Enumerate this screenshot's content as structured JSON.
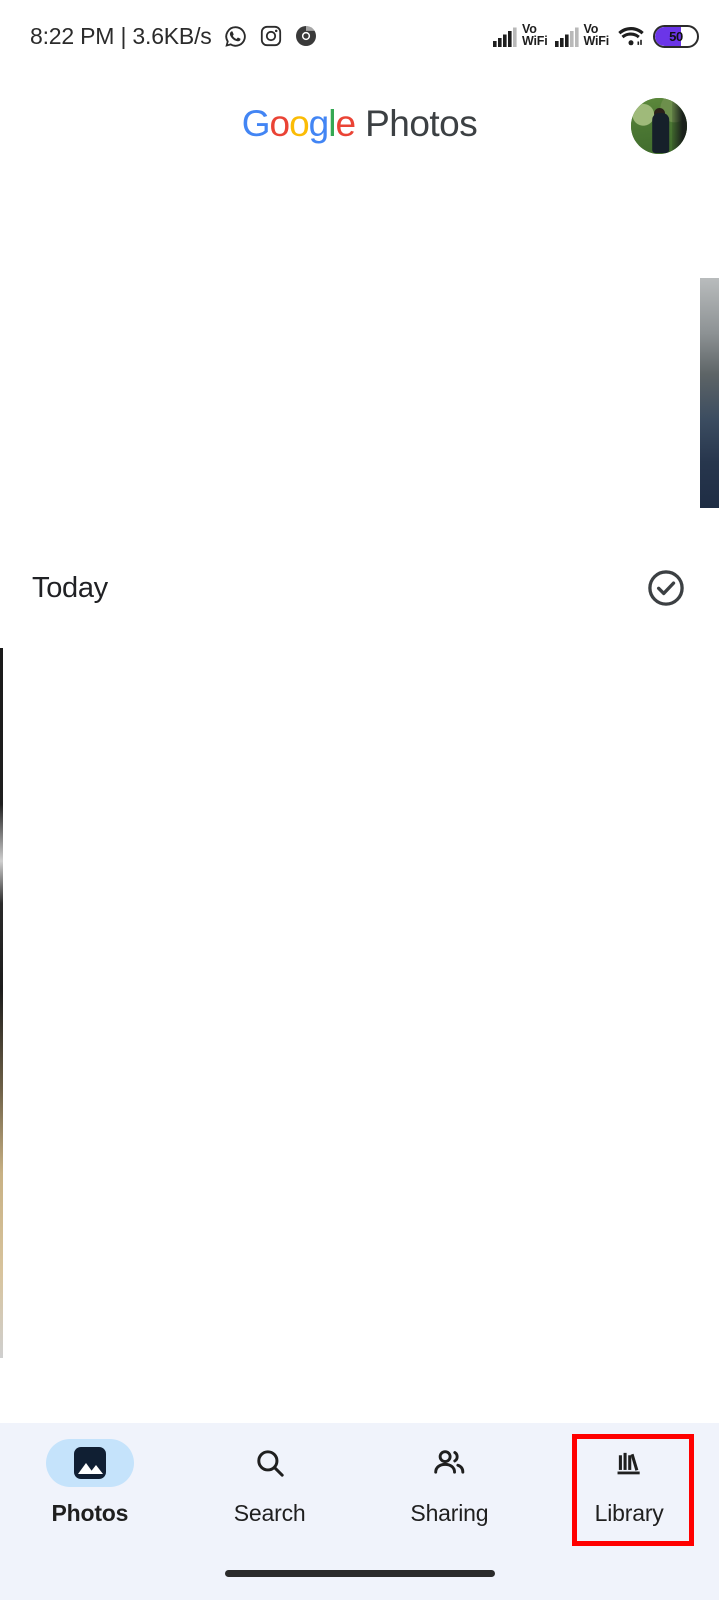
{
  "status_bar": {
    "clock": "8:22 PM | 3.6KB/s",
    "app_icons": [
      "whatsapp-icon",
      "instagram-icon",
      "chrome-icon"
    ],
    "network": [
      {
        "type": "signal-bars-icon",
        "label_top": "Vo",
        "label_bottom": "WiFi"
      },
      {
        "type": "signal-bars-icon",
        "label_top": "Vo",
        "label_bottom": "WiFi"
      }
    ],
    "wifi": "wifi-icon",
    "battery": {
      "level": "50",
      "fill_color": "#6B35E8"
    }
  },
  "header": {
    "brand_google_letters": [
      "G",
      "o",
      "o",
      "g",
      "l",
      "e"
    ],
    "brand_word": "Photos",
    "avatar": "account-avatar"
  },
  "main": {
    "section_title": "Today",
    "select_icon": "check-circle-icon"
  },
  "bottom_nav": {
    "active_index": 0,
    "items": [
      {
        "label": "Photos",
        "icon": "photos-icon",
        "active": true
      },
      {
        "label": "Search",
        "icon": "search-icon",
        "active": false
      },
      {
        "label": "Sharing",
        "icon": "sharing-icon",
        "active": false
      },
      {
        "label": "Library",
        "icon": "library-icon",
        "active": false
      }
    ],
    "background_color": "#F0F3FB",
    "active_pill_color": "#C5E3FB"
  },
  "annotation": {
    "target": "Library",
    "color": "#FF0000"
  }
}
